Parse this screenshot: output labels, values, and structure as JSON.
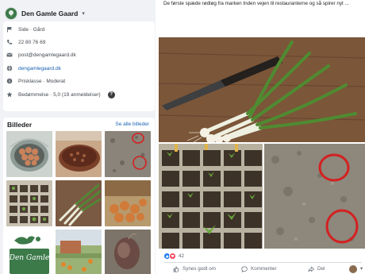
{
  "page": {
    "name": "Den Gamle Gaard",
    "logo_icon": "tree-logo-icon",
    "chevron_icon": "chevron-down-icon"
  },
  "about": {
    "items": [
      {
        "icon": "flag-icon",
        "text": "Side · Gård"
      },
      {
        "icon": "phone-icon",
        "text": "22 80 76 69"
      },
      {
        "icon": "mail-icon",
        "text": "post@dengamlegaard.dk"
      },
      {
        "icon": "globe-icon",
        "text": "dengamlegaard.dk"
      },
      {
        "icon": "info-icon",
        "text": "Prisklasse · Moderat"
      },
      {
        "icon": "star-icon",
        "text": "Bedømmelse · 5,0 (19 anmeldelser)",
        "help": "?"
      }
    ]
  },
  "photos": {
    "title": "Billeder",
    "see_all": "Se alle billeder",
    "thumbs": [
      "eggs-in-wire-basket",
      "plum-tart",
      "soil-with-seedlings-circled",
      "seedling-tray",
      "harvested-spring-onions",
      "potatoes-on-table",
      "den-gamle-logo-poster",
      "garden-with-flowers",
      "sprouting-potato"
    ],
    "logo_poster_text": "Den Gamle"
  },
  "post": {
    "text": "De første spæde rødløg fra marken Inden vejen til restauranterne og så spirer nyt ...",
    "photos": [
      "spring-onions-with-knife",
      "seedling-tray-closeup",
      "soil-with-seedlings-circled"
    ],
    "reactions_count": "42",
    "actions": {
      "like": "Synes godt om",
      "comment": "Kommenter",
      "share": "Del"
    },
    "avatar_chevron": "▾"
  },
  "colors": {
    "background_left": "#f0f2f5",
    "link": "#1a62b5",
    "like_blue": "#1877f2",
    "love_red": "#f33e58",
    "circle_red": "#d42020"
  }
}
